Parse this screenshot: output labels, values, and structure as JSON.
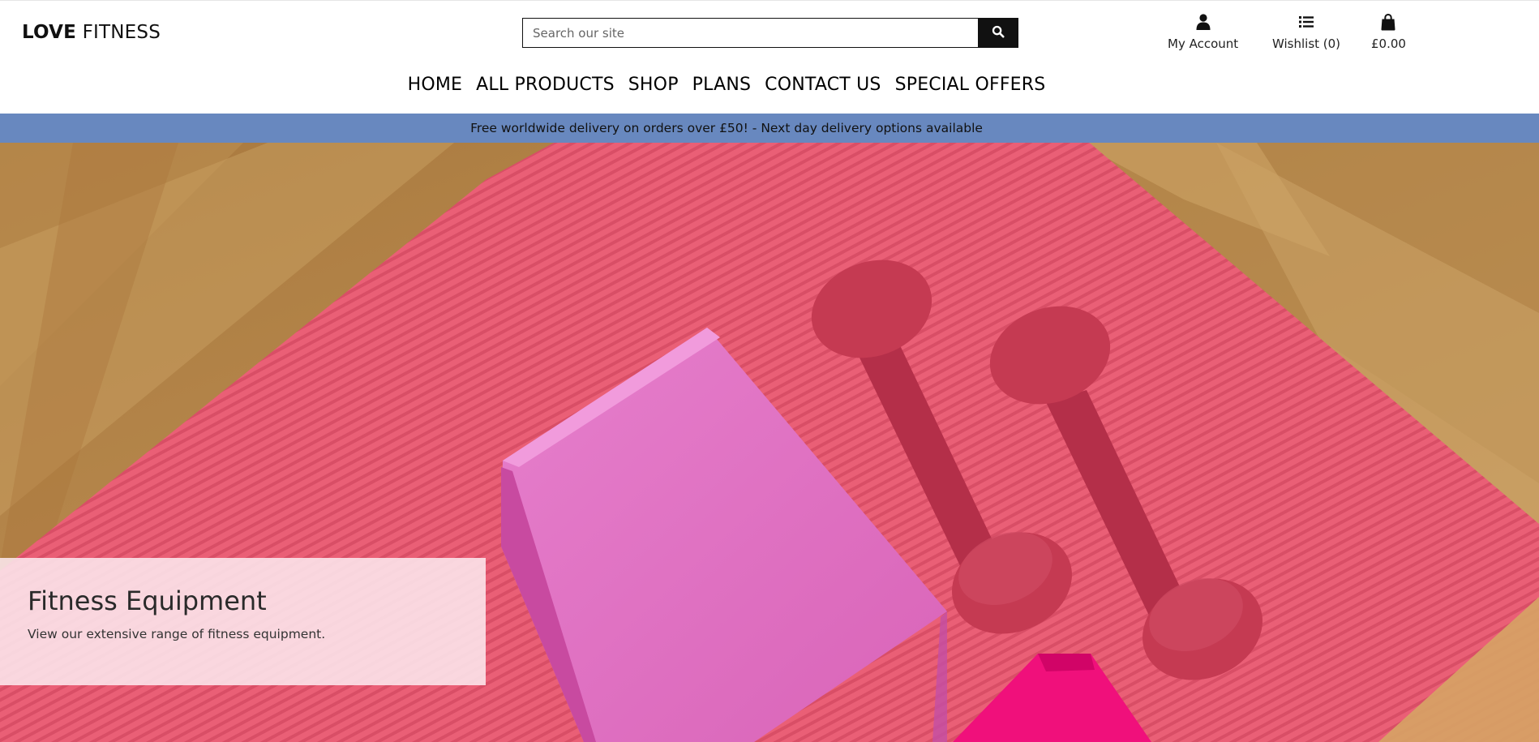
{
  "brand": {
    "bold": "LOVE",
    "light": " FITNESS"
  },
  "search": {
    "placeholder": "Search our site",
    "icon": "search-icon"
  },
  "utility": {
    "account": {
      "label": "My Account",
      "icon": "user-icon"
    },
    "wishlist": {
      "label": "Wishlist (0)",
      "icon": "list-icon"
    },
    "basket": {
      "label": "£0.00",
      "icon": "shopping-bag-icon"
    }
  },
  "nav": {
    "items": [
      "HOME",
      "ALL PRODUCTS",
      "SHOP",
      "PLANS",
      "CONTACT US",
      "SPECIAL OFFERS"
    ]
  },
  "banner": {
    "text": "Free worldwide delivery on orders over £50! - Next day delivery options available"
  },
  "hero": {
    "title": "Fitness Equipment",
    "subtitle": "View our extensive range of fitness equipment."
  },
  "colors": {
    "banner": "#6888bf",
    "mat": "#ea5d74",
    "dumbbell": "#c73a52",
    "block": "#df70bf",
    "floor": "#b78a4e"
  }
}
